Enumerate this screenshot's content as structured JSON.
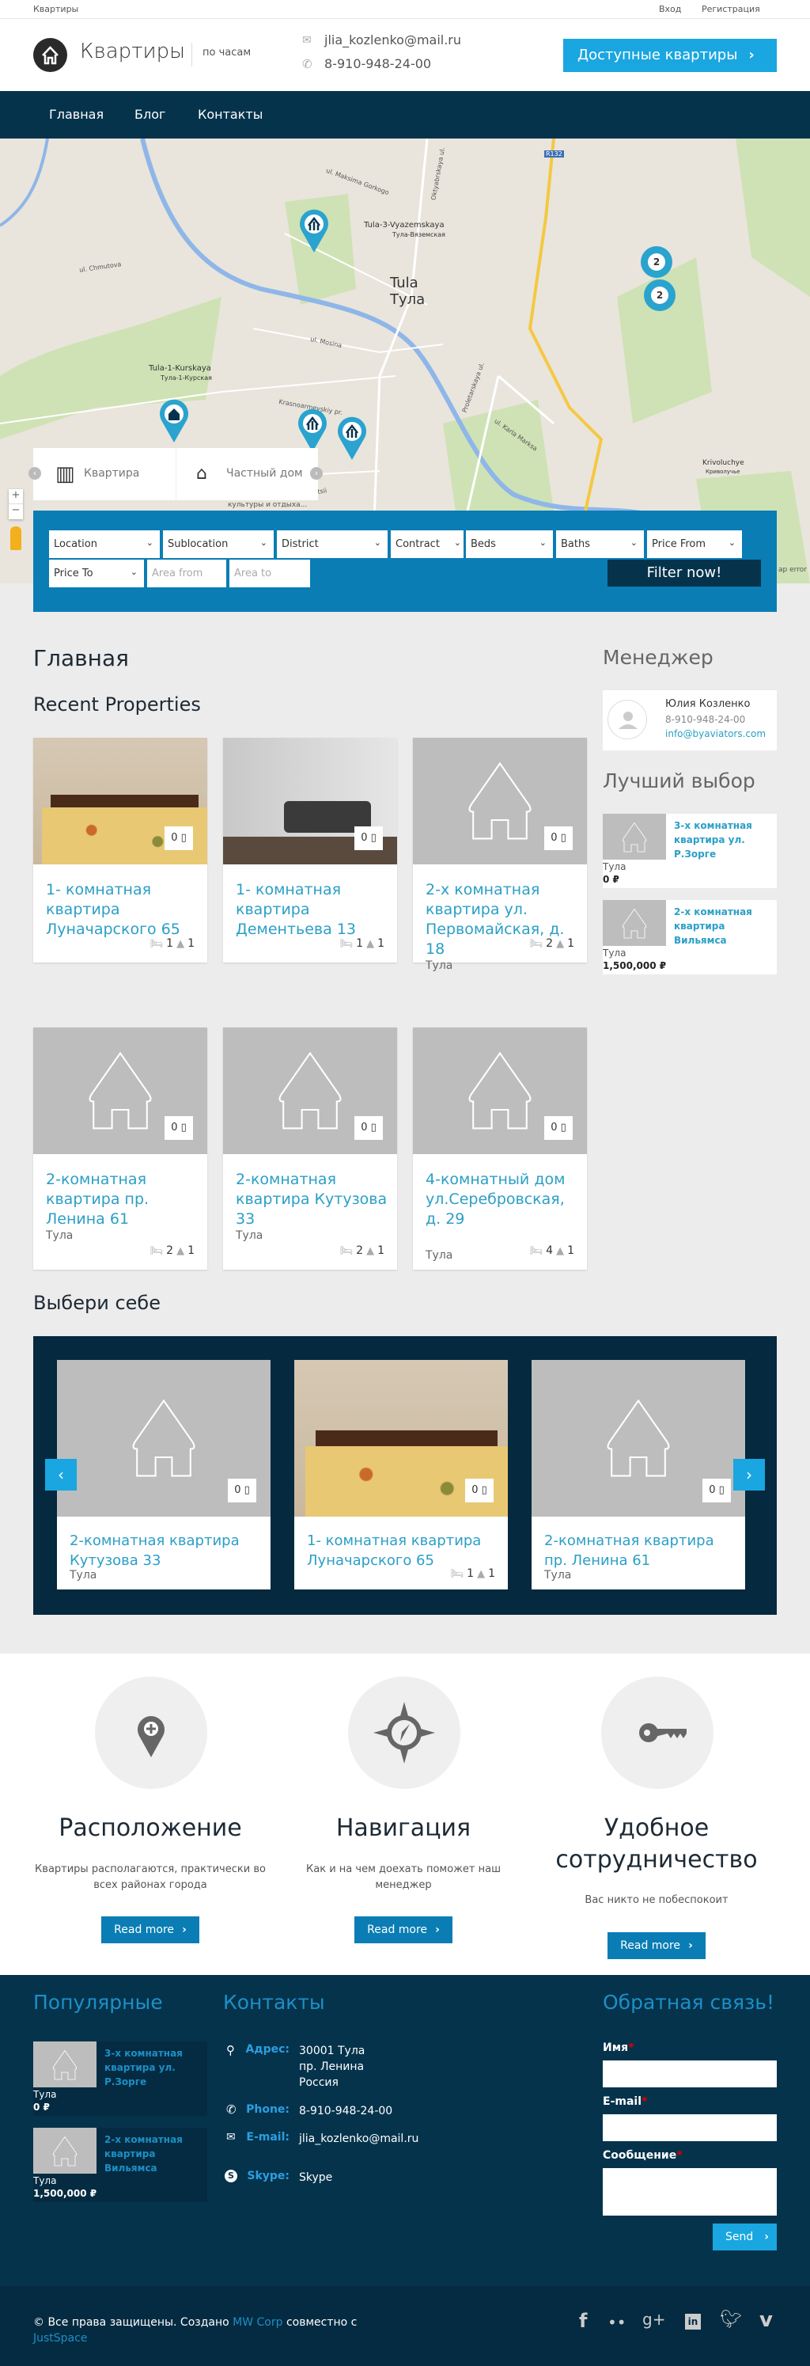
{
  "topbar": {
    "site": "Квартиры",
    "login": "Вход",
    "register": "Регистрация"
  },
  "header": {
    "logo_text": "Квартиры",
    "tagline": "по часам",
    "email": "jlia_kozlenko@mail.ru",
    "phone": "8-910-948-24-00",
    "cta": "Доступные квартиры"
  },
  "nav": [
    "Главная",
    "Блог",
    "Контакты"
  ],
  "map": {
    "labels": {
      "city_en": "Tula",
      "city_ru": "Тула",
      "station1": "Tula-3-Vyazemskaya",
      "station1_ru": "Тула-Вяземская",
      "station2": "Tula-1-Kurskaya",
      "station2_ru": "Тула-1-Курская",
      "road": "R132",
      "krivoluchye": "Krivoluchye",
      "krivoluchye_ru": "Криволучье",
      "street1": "ul. Maksima Gorkogo",
      "street2": "ul. Chmutova",
      "street3": "ul. Mosina",
      "street4": "Krasnoarmeyskiy pr.",
      "street5": "ul. Demonstratsii",
      "street6": "Proletarskaya ul.",
      "street7": "ul. Karla Marksa",
      "street8": "Oktyabrskaya ul.",
      "park": "культуры и отдыха...",
      "error": "ap error"
    },
    "clusters": [
      "2",
      "2"
    ],
    "categories": [
      "Квартира",
      "Частный дом"
    ],
    "zoom_in": "+",
    "zoom_out": "−"
  },
  "filter": {
    "location": "Location",
    "sublocation": "Sublocation",
    "district": "District",
    "contract": "Contract",
    "beds": "Beds",
    "baths": "Baths",
    "price_from": "Price From",
    "price_to": "Price To",
    "area_from": "Area from",
    "area_to": "Area to",
    "submit": "Filter now!"
  },
  "main": {
    "title": "Главная",
    "recent": "Recent Properties",
    "properties": [
      {
        "title": "1- комнатная квартира Луначарского 65",
        "location": "",
        "beds": "1",
        "baths": "1",
        "fav": "0",
        "photo": "bed"
      },
      {
        "title": "1- комнатная квартира Дементьева 13",
        "location": "",
        "beds": "1",
        "baths": "1",
        "fav": "0",
        "photo": "sofa"
      },
      {
        "title": "2-х комнатная квартира ул. Первомайская, д. 18",
        "location": "Тула",
        "beds": "2",
        "baths": "1",
        "fav": "0",
        "photo": ""
      },
      {
        "title": "2-комнатная квартира пр. Ленина 61",
        "location": "Тула",
        "beds": "2",
        "baths": "1",
        "fav": "0",
        "photo": ""
      },
      {
        "title": "2-комнатная квартира Кутузова 33",
        "location": "Тула",
        "beds": "2",
        "baths": "1",
        "fav": "0",
        "photo": ""
      },
      {
        "title": "4-комнатный дом ул.Серебровская, д. 29",
        "location": "Тула",
        "beds": "4",
        "baths": "1",
        "fav": "0",
        "photo": ""
      }
    ]
  },
  "sidebar": {
    "manager_title": "Менеджер",
    "manager": {
      "name": "Юлия Козленко",
      "phone": "8-910-948-24-00",
      "email": "info@byaviators.com"
    },
    "best_title": "Лучший выбор",
    "best": [
      {
        "title": "3-х комнатная квартира ул. Р.Зорге",
        "location": "Тула",
        "price": "0 ₽"
      },
      {
        "title": "2-х комнатная квартира Вильямса",
        "location": "Тула",
        "price": "1,500,000 ₽"
      }
    ]
  },
  "carousel": {
    "title": "Выбери себе",
    "items": [
      {
        "title": "2-комнатная квартира Кутузова 33",
        "location": "Тула",
        "fav": "0",
        "photo": ""
      },
      {
        "title": "1- комнатная квартира Луначарского 65",
        "location": "",
        "beds": "1",
        "baths": "1",
        "fav": "0",
        "photo": "bed"
      },
      {
        "title": "2-комнатная квартира пр. Ленина 61",
        "location": "Тула",
        "fav": "0",
        "photo": ""
      }
    ]
  },
  "features": [
    {
      "title": "Расположение",
      "text": "Квартиры располагаются, практически во всех районах города",
      "button": "Read more",
      "icon": "map-pin-plus-icon"
    },
    {
      "title": "Навигация",
      "text": "Как и на чем доехать поможет наш менеджер",
      "button": "Read more",
      "icon": "compass-icon"
    },
    {
      "title": "Удобное сотрудничество",
      "text": "Вас никто не побеспокоит",
      "button": "Read more",
      "icon": "key-icon"
    }
  ],
  "footer": {
    "popular_title": "Популярные",
    "contacts_title": "Контакты",
    "feedback_title": "Обратная связь!",
    "popular": [
      {
        "title": "3-х комнатная квартира ул. Р.Зорге",
        "location": "Тула",
        "price": "0 ₽"
      },
      {
        "title": "2-х комнатная квартира Вильямса",
        "location": "Тула",
        "price": "1,500,000 ₽"
      }
    ],
    "address_label": "Адрес:",
    "address": [
      "30001 Тула",
      "пр. Ленина",
      "Россия"
    ],
    "phone_label": "Phone:",
    "phone": "8-910-948-24-00",
    "email_label": "E-mail:",
    "email": "jlia_kozlenko@mail.ru",
    "skype_label": "Skype:",
    "skype": "Skype",
    "form": {
      "name": "Имя",
      "email": "E-mail",
      "message": "Сообщение",
      "required": "*",
      "send": "Send"
    }
  },
  "bottom": {
    "copyright": "© Все права защищены. Создано ",
    "corp": "MW Corp",
    "with": " совместно с",
    "justspace": "JustSpace",
    "social": [
      "facebook",
      "flickr",
      "google-plus",
      "linkedin",
      "twitter",
      "vimeo"
    ]
  },
  "colors": {
    "navy": "#05334c",
    "accent": "#1aa6e0",
    "filter_blue": "#0a7db5",
    "link": "#2b9fc6"
  }
}
